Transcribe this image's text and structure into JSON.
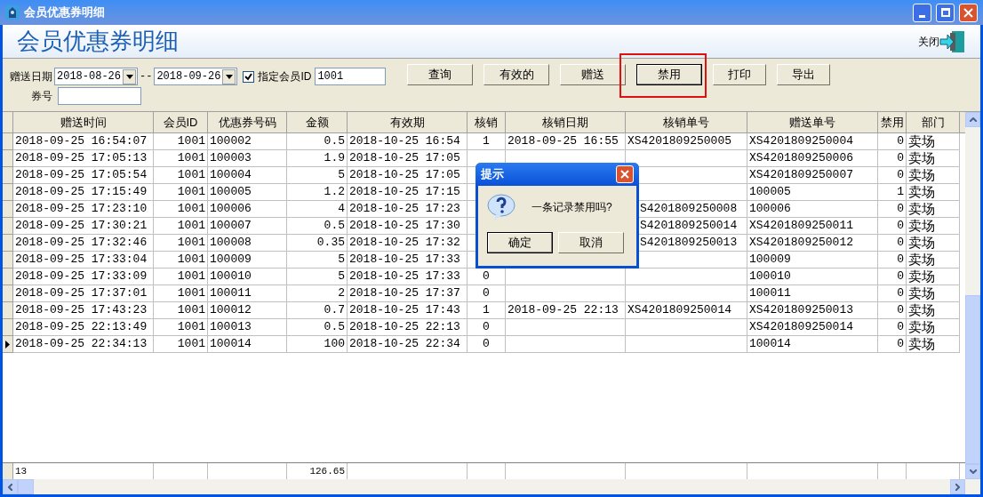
{
  "window": {
    "title": "会员优惠券明细"
  },
  "header": {
    "title": "会员优惠券明细",
    "close_label": "关闭"
  },
  "filters": {
    "date_label": "赠送日期",
    "date_from": "2018-08-26",
    "date_sep": "--",
    "date_to": "2018-09-26",
    "member_check": {
      "label": "指定会员ID",
      "checked": true
    },
    "member_id": "1001",
    "coupon_label": "券号"
  },
  "buttons": [
    {
      "label": "查询",
      "default": false
    },
    {
      "label": "有效的",
      "default": false
    },
    {
      "label": "赠送",
      "default": false
    },
    {
      "label": "禁用",
      "default": true,
      "highlighted": true
    },
    {
      "label": "打印",
      "default": false
    },
    {
      "label": "导出",
      "default": false
    }
  ],
  "table": {
    "columns": [
      {
        "label": "赠送时间"
      },
      {
        "label": "会员ID"
      },
      {
        "label": "优惠券号码"
      },
      {
        "label": "金额"
      },
      {
        "label": "有效期"
      },
      {
        "label": "核销"
      },
      {
        "label": "核销日期"
      },
      {
        "label": "核销单号"
      },
      {
        "label": "赠送单号"
      },
      {
        "label": "禁用"
      },
      {
        "label": "部门"
      }
    ],
    "rows": [
      {
        "selected": false,
        "cells": [
          "2018-09-25 16:54:07",
          "1001",
          "100002",
          "0.5",
          "2018-10-25 16:54",
          "1",
          "2018-09-25 16:55",
          "XS4201809250005",
          "XS4201809250004",
          "0",
          "卖场"
        ]
      },
      {
        "selected": false,
        "cells": [
          "2018-09-25 17:05:13",
          "1001",
          "100003",
          "1.9",
          "2018-10-25 17:05",
          null,
          null,
          null,
          "XS4201809250006",
          "0",
          "卖场"
        ]
      },
      {
        "selected": false,
        "cells": [
          "2018-09-25 17:05:54",
          "1001",
          "100004",
          "5",
          "2018-10-25 17:05",
          null,
          null,
          null,
          "XS4201809250007",
          "0",
          "卖场"
        ]
      },
      {
        "selected": false,
        "cells": [
          "2018-09-25 17:15:49",
          "1001",
          "100005",
          "1.2",
          "2018-10-25 17:15",
          null,
          null,
          null,
          "100005",
          "1",
          "卖场"
        ]
      },
      {
        "selected": false,
        "cells": [
          "2018-09-25 17:23:10",
          "1001",
          "100006",
          "4",
          "2018-10-25 17:23",
          null,
          null,
          "S4201809250008",
          "100006",
          "0",
          "卖场"
        ]
      },
      {
        "selected": false,
        "cells": [
          "2018-09-25 17:30:21",
          "1001",
          "100007",
          "0.5",
          "2018-10-25 17:30",
          null,
          null,
          "S4201809250014",
          "XS4201809250011",
          "0",
          "卖场"
        ]
      },
      {
        "selected": false,
        "cells": [
          "2018-09-25 17:32:46",
          "1001",
          "100008",
          "0.35",
          "2018-10-25 17:32",
          null,
          null,
          "S4201809250013",
          "XS4201809250012",
          "0",
          "卖场"
        ]
      },
      {
        "selected": false,
        "cells": [
          "2018-09-25 17:33:04",
          "1001",
          "100009",
          "5",
          "2018-10-25 17:33",
          null,
          null,
          null,
          "100009",
          "0",
          "卖场"
        ]
      },
      {
        "selected": false,
        "cells": [
          "2018-09-25 17:33:09",
          "1001",
          "100010",
          "5",
          "2018-10-25 17:33",
          "0",
          null,
          null,
          "100010",
          "0",
          "卖场"
        ]
      },
      {
        "selected": false,
        "cells": [
          "2018-09-25 17:37:01",
          "1001",
          "100011",
          "2",
          "2018-10-25 17:37",
          "0",
          null,
          null,
          "100011",
          "0",
          "卖场"
        ]
      },
      {
        "selected": false,
        "cells": [
          "2018-09-25 17:43:23",
          "1001",
          "100012",
          "0.7",
          "2018-10-25 17:43",
          "1",
          "2018-09-25 22:13",
          "XS4201809250014",
          "XS4201809250013",
          "0",
          "卖场"
        ]
      },
      {
        "selected": false,
        "cells": [
          "2018-09-25 22:13:49",
          "1001",
          "100013",
          "0.5",
          "2018-10-25 22:13",
          "0",
          null,
          null,
          "XS4201809250014",
          "0",
          "卖场"
        ]
      },
      {
        "selected": true,
        "cells": [
          "2018-09-25 22:34:13",
          "1001",
          "100014",
          "100",
          "2018-10-25 22:34",
          "0",
          null,
          null,
          "100014",
          "0",
          "卖场"
        ]
      }
    ],
    "footer": {
      "count": "13",
      "amount_total": "126.65"
    }
  },
  "dialog": {
    "title": "提示",
    "message": "一条记录禁用吗?",
    "buttons": [
      {
        "label": "确定",
        "default": true
      },
      {
        "label": "取消",
        "default": false
      }
    ]
  }
}
